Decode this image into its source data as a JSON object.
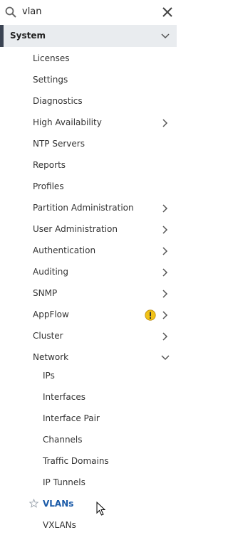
{
  "search": {
    "value": "vlan"
  },
  "section": {
    "title": "System"
  },
  "items": [
    {
      "label": "Licenses"
    },
    {
      "label": "Settings"
    },
    {
      "label": "Diagnostics"
    },
    {
      "label": "High Availability"
    },
    {
      "label": "NTP Servers"
    },
    {
      "label": "Reports"
    },
    {
      "label": "Profiles"
    },
    {
      "label": "Partition Administration"
    },
    {
      "label": "User Administration"
    },
    {
      "label": "Authentication"
    },
    {
      "label": "Auditing"
    },
    {
      "label": "SNMP"
    },
    {
      "label": "AppFlow"
    },
    {
      "label": "Cluster"
    },
    {
      "label": "Network"
    }
  ],
  "network_items": [
    {
      "label": "IPs"
    },
    {
      "label": "Interfaces"
    },
    {
      "label": "Interface Pair"
    },
    {
      "label": "Channels"
    },
    {
      "label": "Traffic Domains"
    },
    {
      "label": "IP Tunnels"
    },
    {
      "label": "VLANs"
    },
    {
      "label": "VXLANs"
    }
  ],
  "colors": {
    "accent": "#1a5aa8",
    "header_bg": "#e9ecef",
    "header_bar": "#3b4453",
    "warning": "#f2c318"
  }
}
